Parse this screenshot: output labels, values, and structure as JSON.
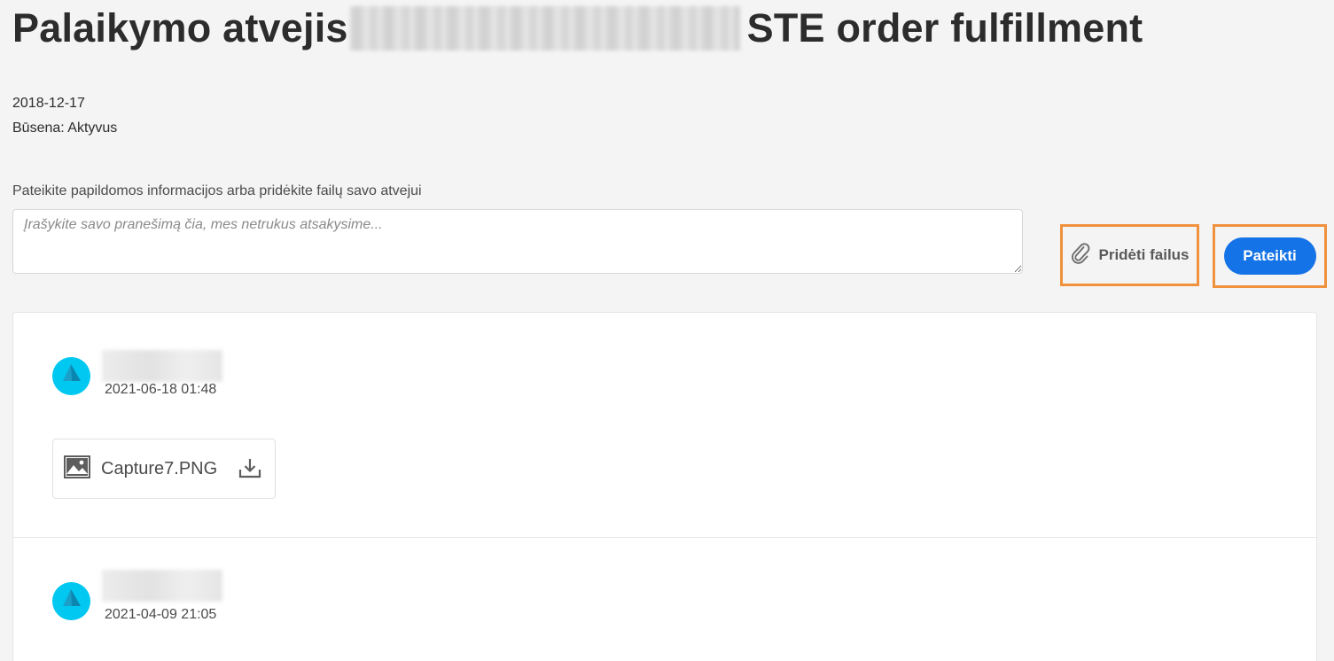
{
  "header": {
    "title_prefix": "Palaikymo atvejis",
    "title_suffix": "STE order fulfillment"
  },
  "case": {
    "date": "2018-12-17",
    "status": "Būsena: Aktyvus"
  },
  "form": {
    "label": "Pateikite papildomos informacijos arba pridėkite failų savo atvejui",
    "placeholder": "Įrašykite savo pranešimą čia, mes netrukus atsakysime...",
    "attach_label": "Pridėti failus",
    "submit_label": "Pateikti"
  },
  "colors": {
    "accent_blue": "#1473e6",
    "highlight_orange": "#f0913e",
    "avatar_cyan": "#00c8f0"
  },
  "thread": {
    "entries": [
      {
        "timestamp": "2021-06-18 01:48",
        "attachment": {
          "file_name": "Capture7.PNG",
          "icon": "image-icon",
          "action_icon": "download-icon"
        }
      },
      {
        "timestamp": "2021-04-09 21:05"
      }
    ]
  }
}
